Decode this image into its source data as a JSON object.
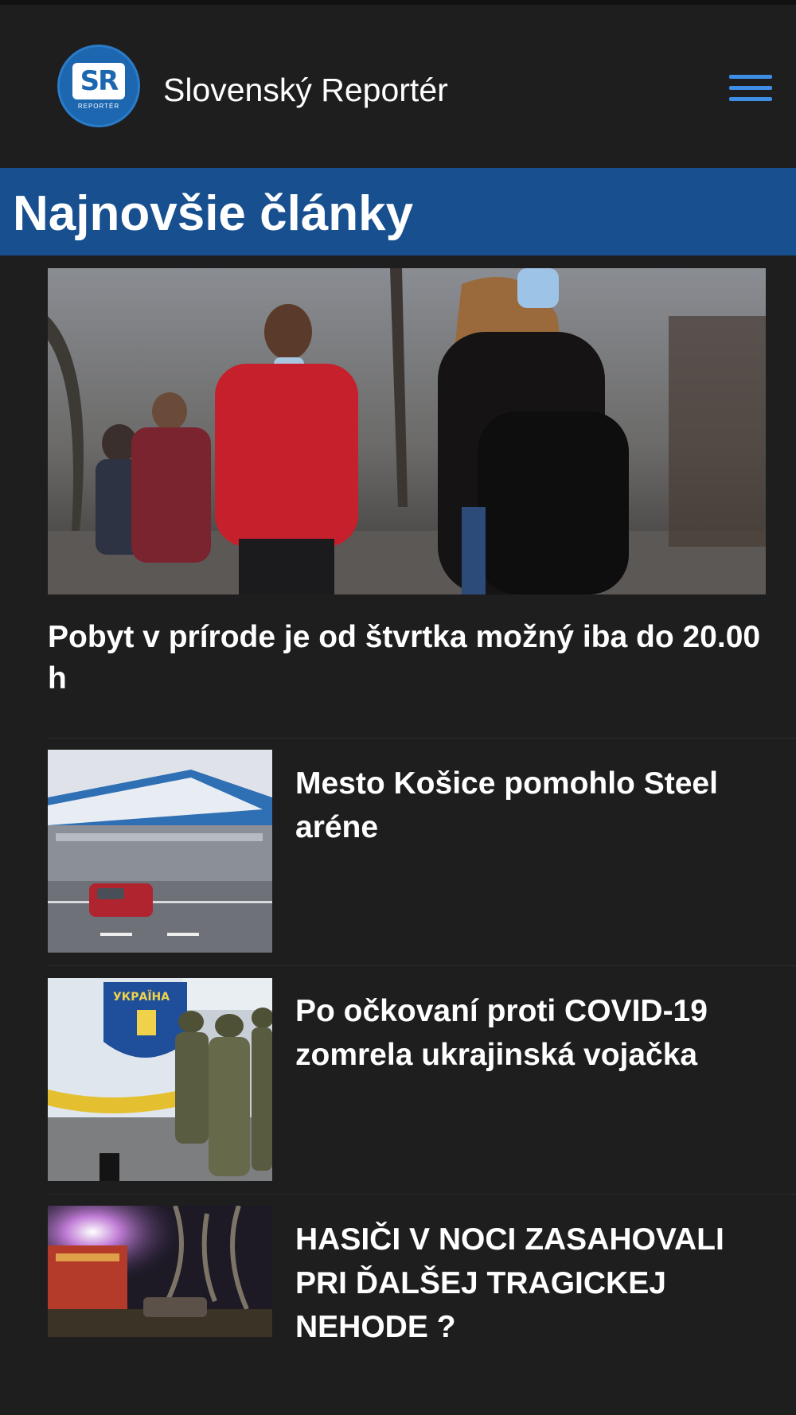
{
  "header": {
    "logo_text": "SR",
    "logo_subtext": "REPORTÉR",
    "site_title": "Slovenský Reportér",
    "menu_icon": "hamburger-menu-icon"
  },
  "section": {
    "title": "Najnovšie články"
  },
  "hero": {
    "title": "Pobyt v prírode je od štvrtka možný iba do 20.00 h",
    "image": "photo-people-wearing-masks"
  },
  "articles": [
    {
      "title": "Mesto Košice pomohlo Steel aréne",
      "image": "photo-steel-arena"
    },
    {
      "title": "Po očkovaní proti COVID-19 zomrela ukrajinská vojačka",
      "image": "photo-ukrainian-soldiers",
      "sign_text": "УКРАЇНА"
    },
    {
      "title": "HASIČI V NOCI ZASAHOVALI PRI ĎALŠEJ TRAGICKEJ NEHODE ?",
      "image": "photo-firefighters-night"
    }
  ],
  "colors": {
    "background": "#1e1e1f",
    "section_bar": "#174f8f",
    "accent": "#3e8ee6",
    "logo_blue": "#1c67b0"
  }
}
